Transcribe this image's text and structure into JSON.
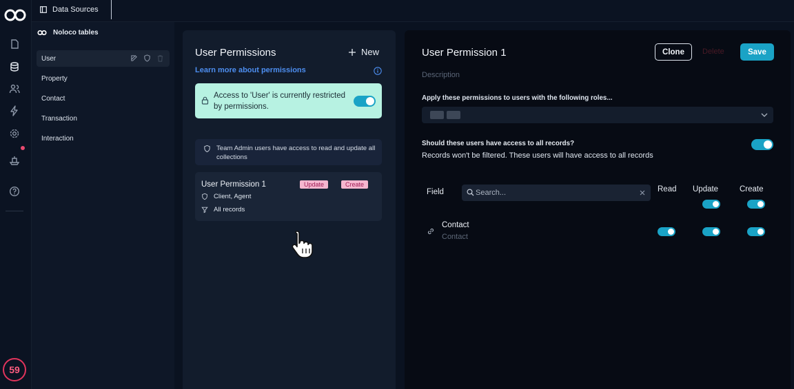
{
  "topbar": {
    "tab_label": "Data Sources"
  },
  "sidebar": {
    "header": "Noloco tables",
    "items": [
      {
        "label": "User"
      },
      {
        "label": "Property"
      },
      {
        "label": "Contact"
      },
      {
        "label": "Transaction"
      },
      {
        "label": "Interaction"
      }
    ]
  },
  "rail": {
    "badge": "59"
  },
  "permissions_list": {
    "title": "User Permissions",
    "new_label": "New",
    "learn_link": "Learn more about permissions",
    "restriction_notice": "Access to 'User' is currently restricted by permissions.",
    "restriction_enabled": true,
    "admin_note": "Team Admin users have access to read and update all collections",
    "cards": [
      {
        "name": "User Permission 1",
        "chips": [
          "Update",
          "Create"
        ],
        "roles": "Client, Agent",
        "filter": "All records"
      }
    ]
  },
  "detail": {
    "title": "User Permission 1",
    "clone_label": "Clone",
    "delete_label": "Delete",
    "save_label": "Save",
    "description_placeholder": "Description",
    "roles_label": "Apply these permissions to users with the following roles...",
    "all_records_question": "Should these users have access to all records?",
    "all_records_hint": "Records won't be filtered. These users will have access to all records",
    "all_records_enabled": true,
    "table": {
      "field_label": "Field",
      "search_placeholder": "Search...",
      "columns": [
        "Read",
        "Update",
        "Create"
      ],
      "column_toggles": {
        "Update": true,
        "Create": true
      },
      "rows": [
        {
          "name": "Contact",
          "sub": "Contact",
          "read": true,
          "update": true,
          "create": true
        }
      ]
    }
  },
  "colors": {
    "accent": "#1aa3c6",
    "notice_bg": "#b7f2e2",
    "chip_bg": "#f5b6cf",
    "link": "#4d8ef0",
    "badge": "#e2345c"
  }
}
